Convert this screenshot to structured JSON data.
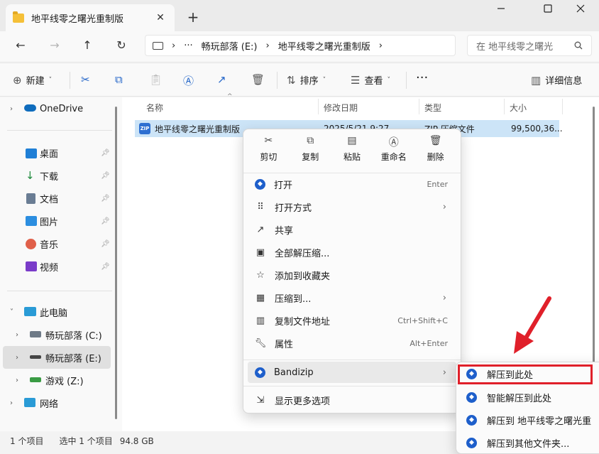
{
  "window": {
    "tab_title": "地平线零之曙光重制版",
    "tab_close": "✕",
    "new_tab": "+"
  },
  "address": {
    "more": "···",
    "crumbs": [
      "畅玩部落 (E:)",
      "地平线零之曙光重制版"
    ],
    "search_placeholder": "在 地平线零之曙光"
  },
  "toolbar": {
    "new_label": "新建",
    "sort_label": "排序",
    "view_label": "查看",
    "more": "···",
    "details_label": "详细信息"
  },
  "sidebar": {
    "onedrive": "OneDrive",
    "quick": [
      {
        "label": "桌面",
        "color": "#1f7fd6"
      },
      {
        "label": "下载",
        "color": "#1e8a3c"
      },
      {
        "label": "文档",
        "color": "#6a7d94"
      },
      {
        "label": "图片",
        "color": "#2c8ee0"
      },
      {
        "label": "音乐",
        "color": "#e0604a"
      },
      {
        "label": "视频",
        "color": "#7a3cc9"
      }
    ],
    "this_pc": "此电脑",
    "drives": [
      "畅玩部落 (C:)",
      "畅玩部落 (E:)",
      "游戏 (Z:)"
    ],
    "network": "网络"
  },
  "columns": [
    "名称",
    "修改日期",
    "类型",
    "大小"
  ],
  "file": {
    "name": "地平线零之曙光重制版",
    "date": "2025/5/21 9:27",
    "type": "ZIP 压缩文件",
    "size": "99,500,36..."
  },
  "context_menu": {
    "quick_actions": [
      "剪切",
      "复制",
      "粘贴",
      "重命名",
      "删除"
    ],
    "items": [
      {
        "label": "打开",
        "shortcut": "Enter"
      },
      {
        "label": "打开方式",
        "submenu": true
      },
      {
        "label": "共享"
      },
      {
        "label": "全部解压缩..."
      },
      {
        "label": "添加到收藏夹"
      },
      {
        "label": "压缩到...",
        "submenu": true
      },
      {
        "label": "复制文件地址",
        "shortcut": "Ctrl+Shift+C"
      },
      {
        "label": "属性",
        "shortcut": "Alt+Enter"
      }
    ],
    "bandizip": "Bandizip",
    "more_options": "显示更多选项"
  },
  "bandizip_submenu": [
    "解压到此处",
    "智能解压到此处",
    "解压到 地平线零之曙光重",
    "解压到其他文件夹..."
  ],
  "status": {
    "count": "1 个项目",
    "selected": "选中 1 个项目",
    "size": "94.8 GB"
  },
  "accent": "#0067c0",
  "highlight_color": "#e0202a"
}
